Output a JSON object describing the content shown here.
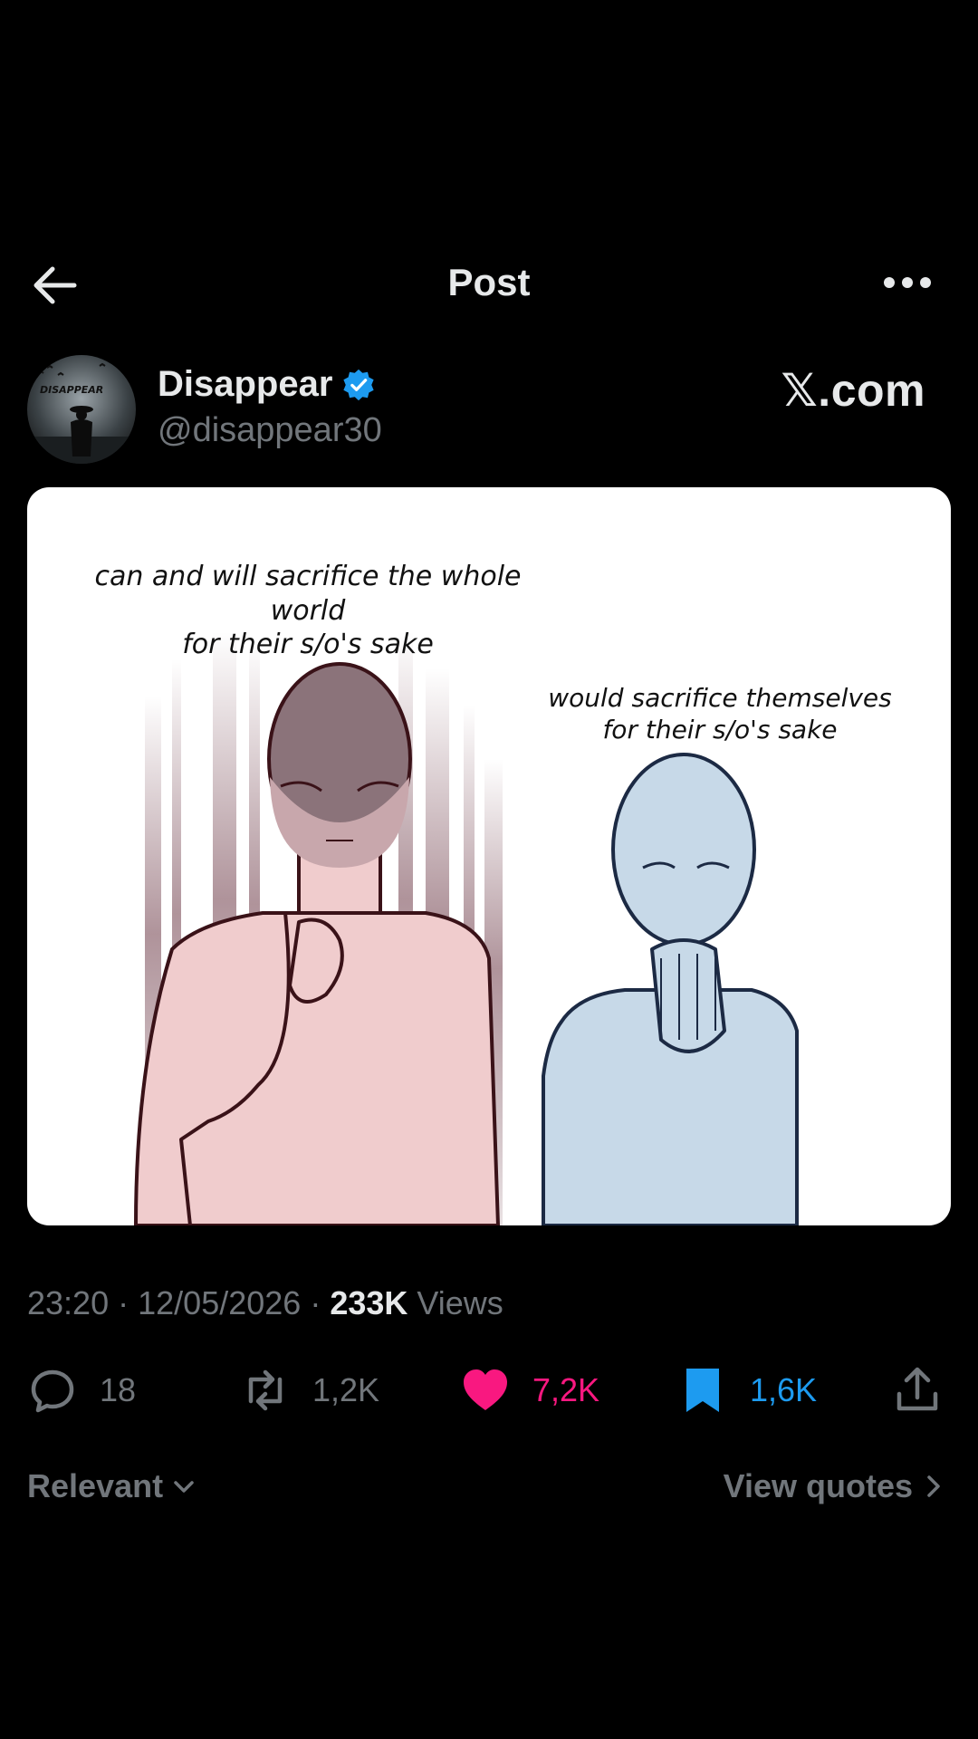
{
  "header": {
    "title": "Post",
    "back_icon": "arrow-left-icon",
    "more_icon": "more-horizontal-icon"
  },
  "author": {
    "display_name": "Disappear",
    "handle": "@disappear30",
    "verified": true,
    "avatar_text": "DISAPPEAR"
  },
  "watermark": "𝕏.com",
  "media": {
    "caption_left_line1": "can and will sacrifice the whole world",
    "caption_left_line2": "for their s/o's sake",
    "caption_right_line1": "would sacrifice themselves",
    "caption_right_line2": "for their s/o's sake"
  },
  "meta": {
    "time": "23:20",
    "date": "12/05/2026",
    "views_count": "233K",
    "views_label": "Views",
    "separator": "·"
  },
  "actions": {
    "replies": "18",
    "reposts": "1,2K",
    "likes": "7,2K",
    "bookmarks": "1,6K"
  },
  "colors": {
    "like": "#f91880",
    "bookmark": "#1d9bf0",
    "muted": "#71767b",
    "text": "#e7e9ea"
  },
  "footer": {
    "sort_label": "Relevant",
    "view_quotes_label": "View quotes"
  }
}
